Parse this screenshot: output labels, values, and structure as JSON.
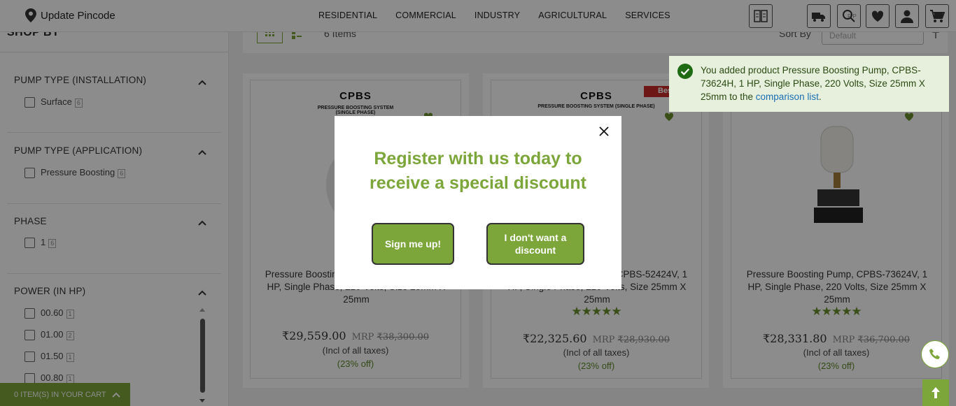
{
  "header": {
    "pincode_label": "Update Pincode",
    "nav": [
      "RESIDENTIAL",
      "COMMERCIAL",
      "INDUSTRY",
      "AGRICULTURAL",
      "SERVICES"
    ],
    "search_hint": "P P"
  },
  "sidebar": {
    "title": "SHOP BY",
    "groups": [
      {
        "title": "PUMP TYPE (INSTALLATION)",
        "options": [
          {
            "label": "Surface",
            "count": "6"
          }
        ]
      },
      {
        "title": "PUMP TYPE (APPLICATION)",
        "options": [
          {
            "label": "Pressure Boosting",
            "count": "6"
          }
        ]
      },
      {
        "title": "PHASE",
        "options": [
          {
            "label": "1",
            "count": "6"
          }
        ]
      },
      {
        "title": "POWER (IN HP)",
        "options": [
          {
            "label": "00.60",
            "count": "1"
          },
          {
            "label": "01.00",
            "count": "2"
          },
          {
            "label": "01.50",
            "count": "1"
          },
          {
            "label": "00.80",
            "count": "1"
          }
        ]
      }
    ],
    "cart": "0 ITEM(S) IN YOUR CART"
  },
  "toolbar": {
    "items_count": "6 Items",
    "sort_label": "Sort By",
    "sort_value": "Default"
  },
  "products": [
    {
      "brand": "CPBS",
      "brand_sub": "PRESSURE BOOSTING SYSTEM (SINGLE PHASE)",
      "name": "Pressure Boosting Pump, CPBS-73624H, 1 HP, Single Phase, 220 Volts, Size 25mm X 25mm",
      "price": "₹29,559.00",
      "mrp_label": "MRP",
      "mrp": "₹38,300.00",
      "taxes": "(Incl of all taxes)",
      "off": "(23% off)",
      "rating": "",
      "badge": ""
    },
    {
      "brand": "CPBS",
      "brand_sub": "PRESSURE BOOSTING SYSTEM (SINGLE PHASE)",
      "name": "Pressure Boosting Pump, CPBS-52424V, 1 HP, Single Phase, 220 Volts, Size 25mm X 25mm",
      "price": "₹22,325.60",
      "mrp_label": "MRP",
      "mrp": "₹28,930.00",
      "taxes": "(Incl of all taxes)",
      "off": "(23% off)",
      "rating": "★★★★★",
      "badge": "Best"
    },
    {
      "brand": "",
      "brand_sub": "",
      "name": "Pressure Boosting Pump, CPBS-73624V, 1 HP, Single Phase, 220 Volts, Size 25mm X 25mm",
      "price": "₹28,331.80",
      "mrp_label": "MRP",
      "mrp": "₹36,700.00",
      "taxes": "(Incl of all taxes)",
      "off": "(23% off)",
      "rating": "★★★★★",
      "badge": ""
    }
  ],
  "modal": {
    "title": "Register with us today to receive a special discount",
    "signup": "Sign me up!",
    "decline": "I don't want a discount"
  },
  "toast": {
    "text": "You added product Pressure Boosting Pump, CPBS-73624H, 1 HP, Single Phase, 220 Volts, Size 25mm X 25mm to the ",
    "link": "comparison list",
    "tail": "."
  },
  "colors": {
    "accent": "#7ca53a",
    "toast_bg": "#e6f0dd",
    "badge": "#c92a2a"
  }
}
